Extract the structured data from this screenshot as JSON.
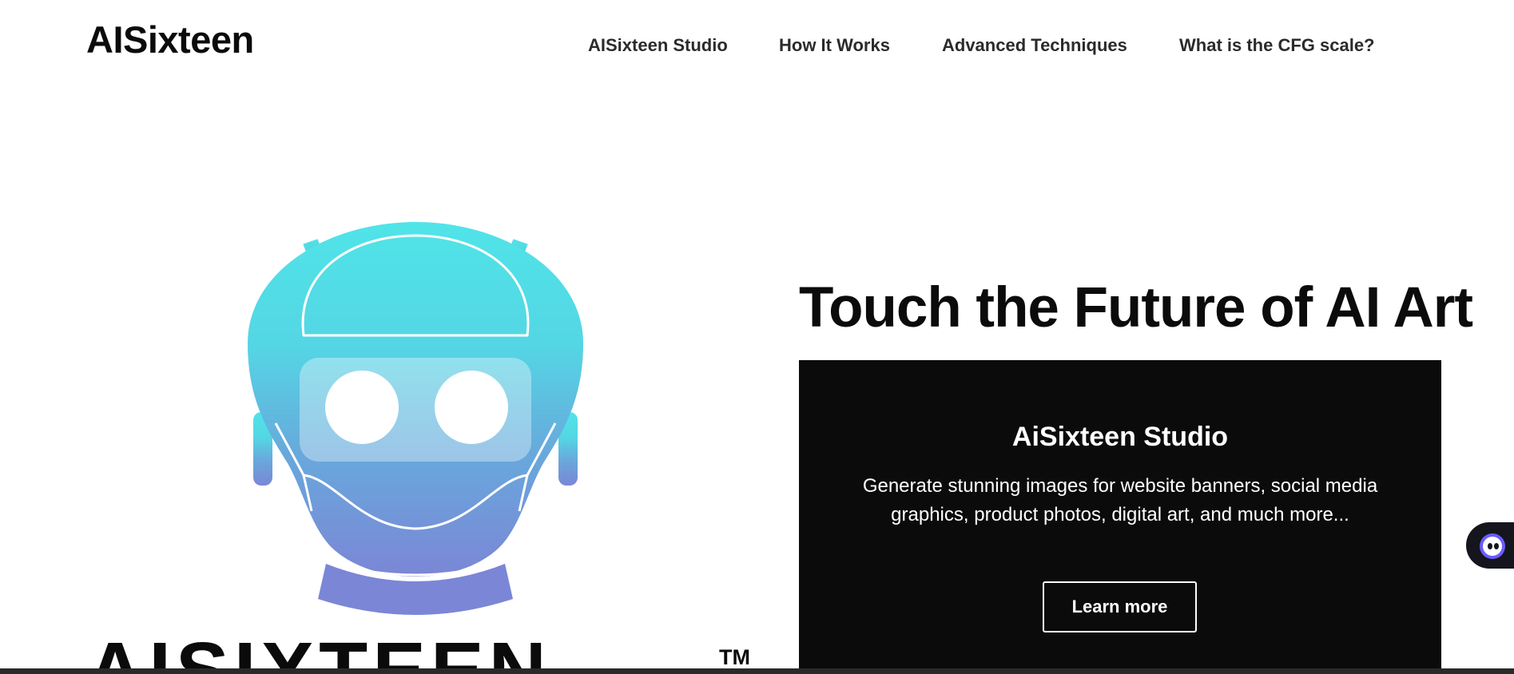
{
  "header": {
    "logo": "AISixteen",
    "nav": [
      {
        "label": "AISixteen Studio"
      },
      {
        "label": "How It Works"
      },
      {
        "label": "Advanced Techniques"
      },
      {
        "label": "What is the CFG scale?"
      }
    ]
  },
  "brand": {
    "wordmark": "AISIXTEEN",
    "trademark": "TM",
    "robot_icon": "robot-mascot-icon",
    "colors": {
      "gradient_top": "#4fe3e7",
      "gradient_bottom": "#7b83d6"
    }
  },
  "hero": {
    "title": "Touch the Future of AI Art",
    "card": {
      "title": "AiSixteen Studio",
      "text": "Generate stunning images for website banners, social media graphics, product photos, digital art, and much more...",
      "button_label": "Learn more",
      "background": "#0b0b0b"
    }
  },
  "widget": {
    "icon": "assistant-bot-icon"
  }
}
